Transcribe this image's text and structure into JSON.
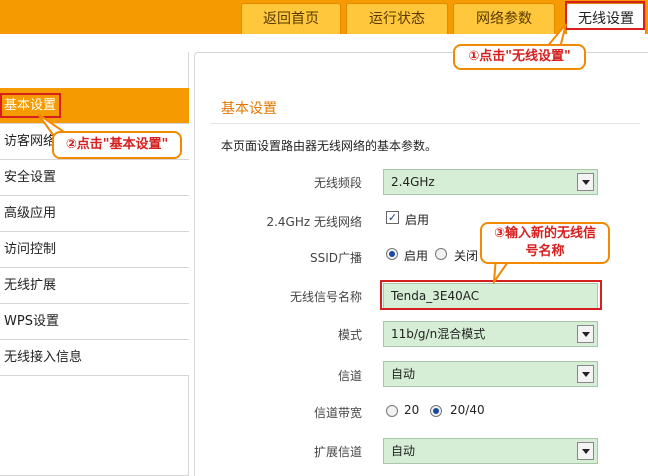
{
  "tabs": [
    {
      "label": "返回首页"
    },
    {
      "label": "运行状态"
    },
    {
      "label": "网络参数"
    },
    {
      "label": "无线设置"
    }
  ],
  "sidebar": {
    "items": [
      {
        "label": "基本设置"
      },
      {
        "label": "访客网络"
      },
      {
        "label": "安全设置"
      },
      {
        "label": "高级应用"
      },
      {
        "label": "访问控制"
      },
      {
        "label": "无线扩展"
      },
      {
        "label": "WPS设置"
      },
      {
        "label": "无线接入信息"
      }
    ]
  },
  "main": {
    "title": "基本设置",
    "description": "本页面设置路由器无线网络的基本参数。",
    "band_label": "无线频段",
    "band_value": "2.4GHz",
    "network_label": "2.4GHz 无线网络",
    "network_option": "启用",
    "ssid_broadcast_label": "SSID广播",
    "ssid_on": "启用",
    "ssid_off": "关闭",
    "ssid_name_label": "无线信号名称",
    "ssid_name_value": "Tenda_3E40AC",
    "mode_label": "模式",
    "mode_value": "11b/g/n混合模式",
    "channel_label": "信道",
    "channel_value": "自动",
    "bandwidth_label": "信道带宽",
    "bw_20": "20",
    "bw_2040": "20/40",
    "ext_channel_label": "扩展信道",
    "ext_channel_value": "自动"
  },
  "callouts": {
    "step1": "①点击\"无线设置\"",
    "step2": "②点击\"基本设置\"",
    "step3_line1": "③输入新的无线信",
    "step3_line2": "号名称"
  },
  "colors": {
    "accent": "#f59a00",
    "highlight": "#d62020",
    "field_bg": "#d6eed6"
  }
}
